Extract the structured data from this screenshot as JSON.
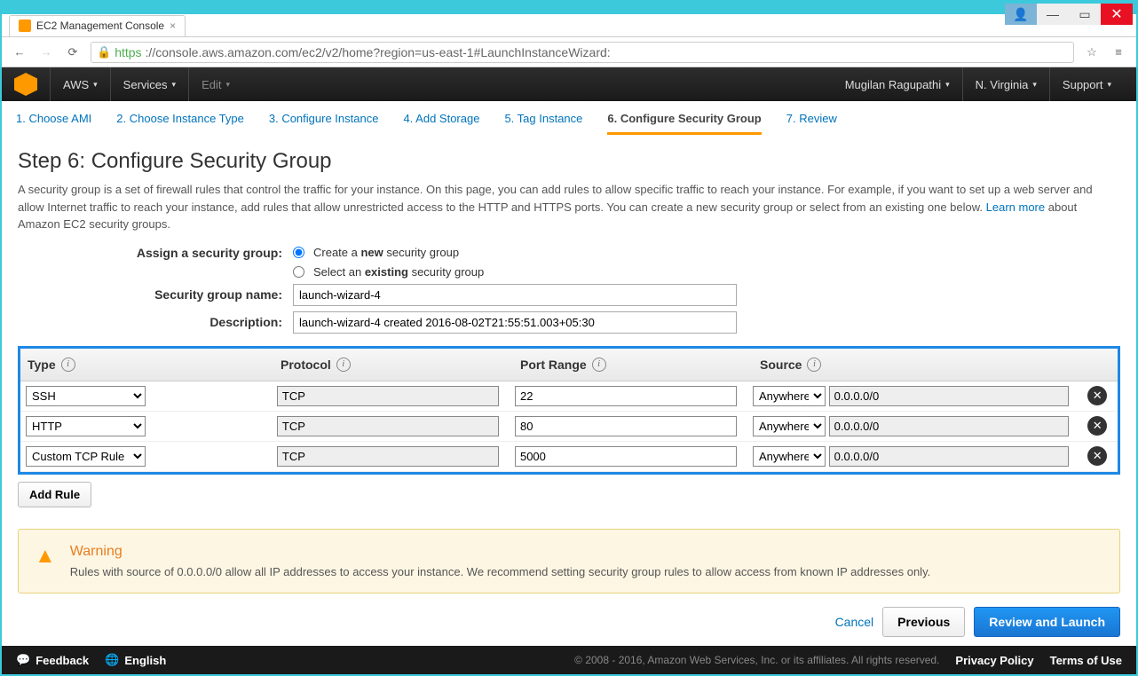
{
  "browser": {
    "tab_title": "EC2 Management Console",
    "url_secure": "https",
    "url_rest": "://console.aws.amazon.com/ec2/v2/home?region=us-east-1#LaunchInstanceWizard:"
  },
  "header": {
    "aws": "AWS",
    "services": "Services",
    "edit": "Edit",
    "user": "Mugilan Ragupathi",
    "region": "N. Virginia",
    "support": "Support"
  },
  "wizard": {
    "tabs": [
      "1. Choose AMI",
      "2. Choose Instance Type",
      "3. Configure Instance",
      "4. Add Storage",
      "5. Tag Instance",
      "6. Configure Security Group",
      "7. Review"
    ],
    "active_index": 5
  },
  "page": {
    "title": "Step 6: Configure Security Group",
    "desc_before": "A security group is a set of firewall rules that control the traffic for your instance. On this page, you can add rules to allow specific traffic to reach your instance. For example, if you want to set up a web server and allow Internet traffic to reach your instance, add rules that allow unrestricted access to the HTTP and HTTPS ports. You can create a new security group or select from an existing one below. ",
    "learn_more": "Learn more",
    "desc_after": " about Amazon EC2 security groups."
  },
  "form": {
    "assign_label": "Assign a security group:",
    "create_prefix": "Create a ",
    "create_bold": "new",
    "create_suffix": " security group",
    "select_prefix": "Select an ",
    "select_bold": "existing",
    "select_suffix": " security group",
    "name_label": "Security group name:",
    "name_value": "launch-wizard-4",
    "desc_label": "Description:",
    "desc_value": "launch-wizard-4 created 2016-08-02T21:55:51.003+05:30"
  },
  "table": {
    "headers": {
      "type": "Type",
      "protocol": "Protocol",
      "port": "Port Range",
      "source": "Source"
    },
    "rows": [
      {
        "type": "SSH",
        "protocol": "TCP",
        "port": "22",
        "source": "Anywhere",
        "cidr": "0.0.0.0/0"
      },
      {
        "type": "HTTP",
        "protocol": "TCP",
        "port": "80",
        "source": "Anywhere",
        "cidr": "0.0.0.0/0"
      },
      {
        "type": "Custom TCP Rule",
        "protocol": "TCP",
        "port": "5000",
        "source": "Anywhere",
        "cidr": "0.0.0.0/0"
      }
    ],
    "add_rule": "Add Rule"
  },
  "warning": {
    "title": "Warning",
    "text": "Rules with source of 0.0.0.0/0 allow all IP addresses to access your instance. We recommend setting security group rules to allow access from known IP addresses only."
  },
  "buttons": {
    "cancel": "Cancel",
    "previous": "Previous",
    "launch": "Review and Launch"
  },
  "footer": {
    "feedback": "Feedback",
    "english": "English",
    "copyright": "© 2008 - 2016, Amazon Web Services, Inc. or its affiliates. All rights reserved.",
    "privacy": "Privacy Policy",
    "terms": "Terms of Use"
  }
}
